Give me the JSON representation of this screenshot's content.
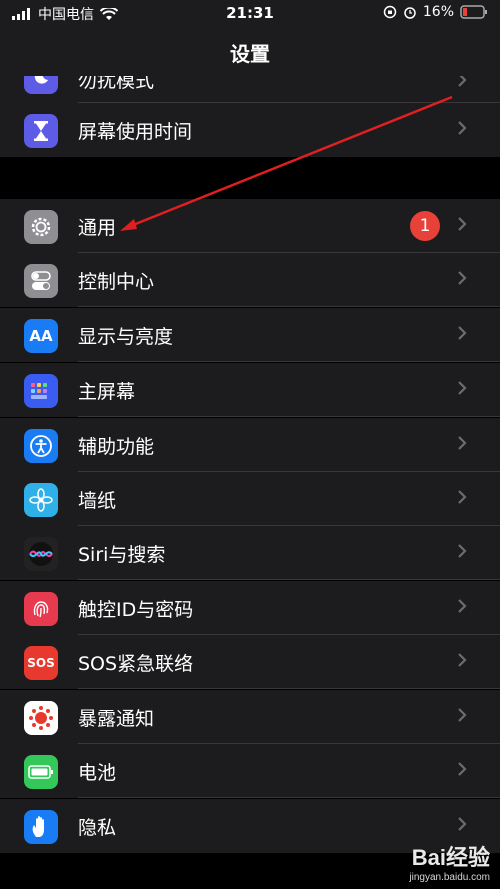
{
  "status_bar": {
    "carrier": "中国电信",
    "time": "21:31",
    "battery": "16%"
  },
  "nav": {
    "title": "设置"
  },
  "rows_top": [
    {
      "label": "勿扰模式"
    },
    {
      "label": "屏幕使用时间"
    }
  ],
  "rows_main": [
    {
      "label": "通用",
      "badge": "1",
      "icon": "gear-icon",
      "color": "#8e8e93"
    },
    {
      "label": "控制中心",
      "icon": "toggles-icon",
      "color": "#8e8e93"
    },
    {
      "label": "显示与亮度",
      "icon_text": "AA",
      "icon": "display-icon",
      "color": "#1a7cf5"
    },
    {
      "label": "主屏幕",
      "icon": "home-grid-icon",
      "color": "#3a5cf0"
    },
    {
      "label": "辅助功能",
      "icon": "accessibility-icon",
      "color": "#1a7cf5"
    },
    {
      "label": "墙纸",
      "icon": "flower-icon",
      "color": "#30b0e8"
    },
    {
      "label": "Siri与搜索",
      "icon": "siri-icon",
      "color": "#222"
    },
    {
      "label": "触控ID与密码",
      "icon": "fingerprint-icon",
      "color": "#e83a4e"
    },
    {
      "label": "SOS紧急联络",
      "icon_text": "SOS",
      "icon": "sos-icon",
      "color": "#e8392e"
    },
    {
      "label": "暴露通知",
      "icon": "exposure-icon",
      "color": "#ffffff"
    },
    {
      "label": "电池",
      "icon": "battery-icon",
      "color": "#34c759"
    },
    {
      "label": "隐私",
      "icon": "hand-icon",
      "color": "#1a7cf5"
    }
  ],
  "watermark": {
    "main": "Bai经验",
    "sub": "jingyan.baidu.com"
  }
}
